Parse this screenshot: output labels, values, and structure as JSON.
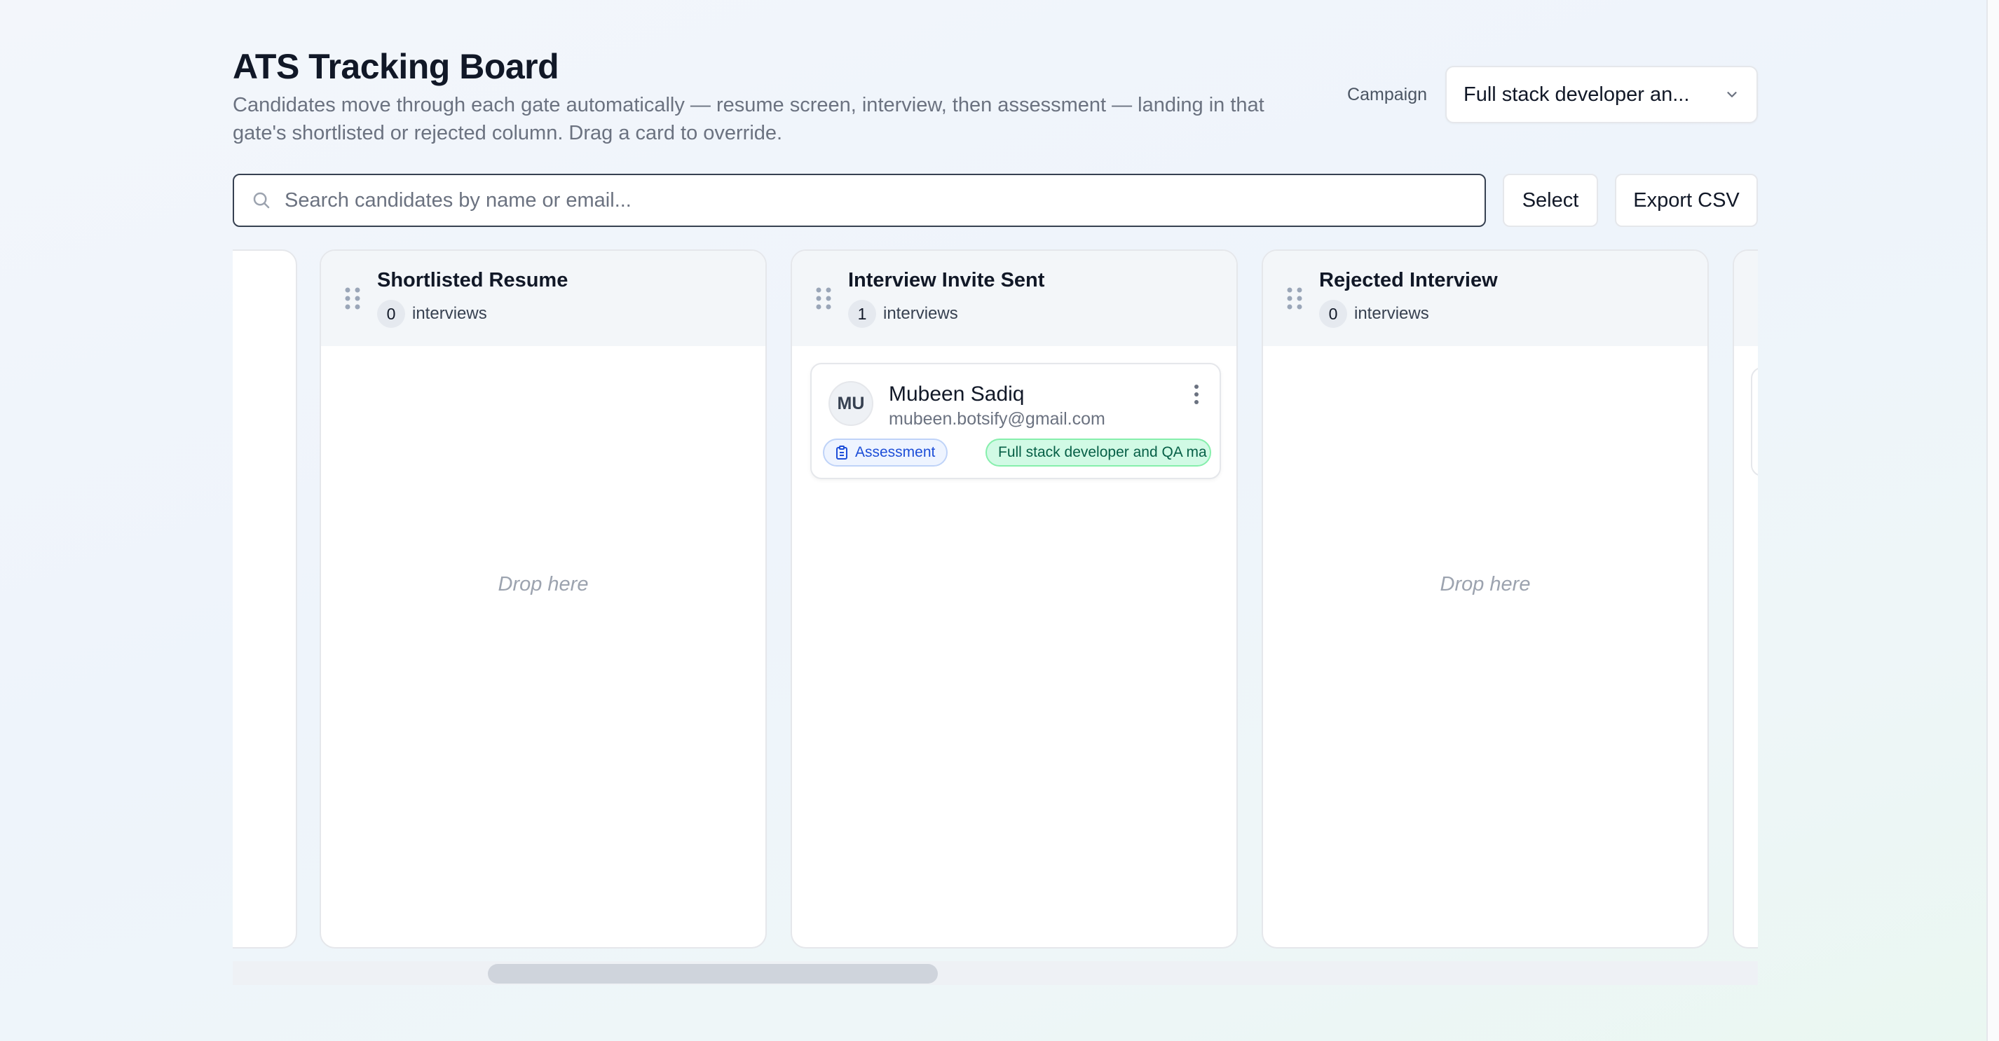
{
  "header": {
    "title": "ATS Tracking Board",
    "subtitle": "Candidates move through each gate automatically — resume screen, interview, then assessment — landing in that gate's shortlisted or rejected column. Drag a card to override."
  },
  "campaign": {
    "label": "Campaign",
    "selected": "Full stack developer an..."
  },
  "search": {
    "placeholder": "Search candidates by name or email..."
  },
  "toolbar": {
    "select_label": "Select",
    "export_label": "Export CSV"
  },
  "columns": [
    {
      "title": "Shortlisted Resume",
      "count": "0",
      "count_label": "interviews",
      "empty_text": "Drop here"
    },
    {
      "title": "Interview Invite Sent",
      "count": "1",
      "count_label": "interviews",
      "cards": [
        {
          "initials": "MU",
          "name": "Mubeen Sadiq",
          "email": "mubeen.botsify@gmail.com",
          "stage_tag": "Assessment",
          "campaign_tag": "Full stack developer and QA ma"
        }
      ]
    },
    {
      "title": "Rejected Interview",
      "count": "0",
      "count_label": "interviews",
      "empty_text": "Drop here"
    }
  ],
  "icons": {
    "search": "search-icon",
    "chevron": "chevron-down-icon",
    "grip": "drag-handle-icon",
    "kebab": "more-vertical-icon",
    "clipboard": "clipboard-icon"
  },
  "colors": {
    "background": "#eef4fb",
    "assessment_tag": "#1d4ed8",
    "campaign_tag": "#065f46",
    "campaign_tag_bg": "#d1fae5"
  }
}
